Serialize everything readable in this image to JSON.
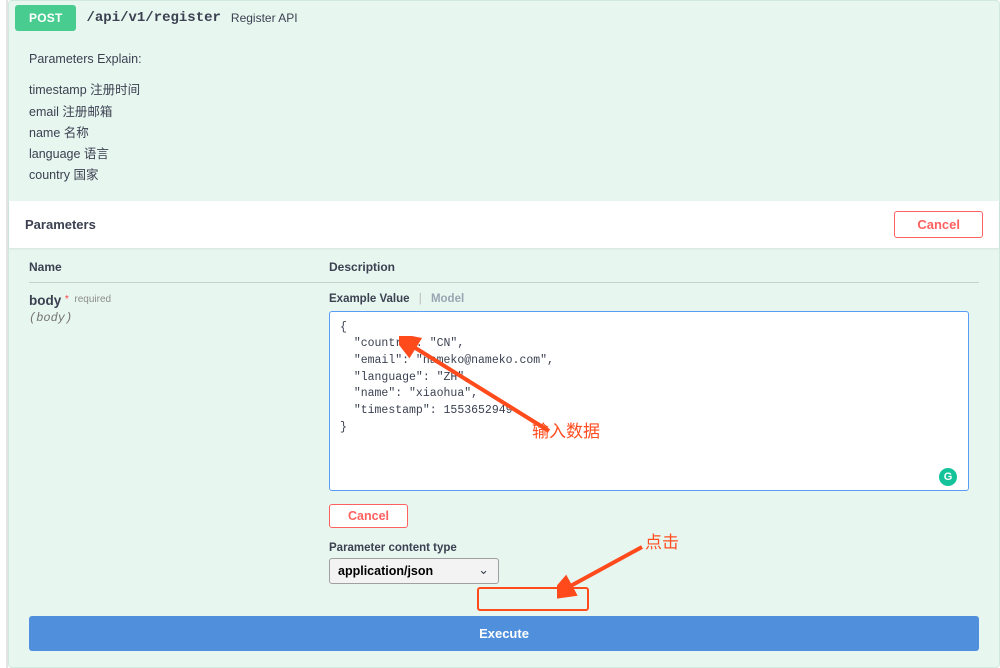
{
  "op": {
    "method": "POST",
    "path": "/api/v1/register",
    "summary": "Register API"
  },
  "notes": {
    "title": "Parameters Explain:",
    "lines": [
      "timestamp 注册时间",
      "email 注册邮箱",
      "name 名称",
      "language 语言",
      "country 国家"
    ]
  },
  "params_bar": {
    "title": "Parameters",
    "cancel": "Cancel"
  },
  "table": {
    "name_header": "Name",
    "desc_header": "Description"
  },
  "param": {
    "name": "body",
    "required_label": "required",
    "in": "(body)"
  },
  "tabs": {
    "example": "Example Value",
    "model": "Model"
  },
  "body_value": "{\n  \"country\": \"CN\",\n  \"email\": \"nameko@nameko.com\",\n  \"language\": \"ZH\",\n  \"name\": \"xiaohua\",\n  \"timestamp\": 1553652949\n}",
  "badge": "G",
  "cancel_small": "Cancel",
  "content_type": {
    "label": "Parameter content type",
    "value": "application/json"
  },
  "execute": "Execute",
  "annotations": {
    "input_hint": "输入数据",
    "click_hint": "点击"
  }
}
